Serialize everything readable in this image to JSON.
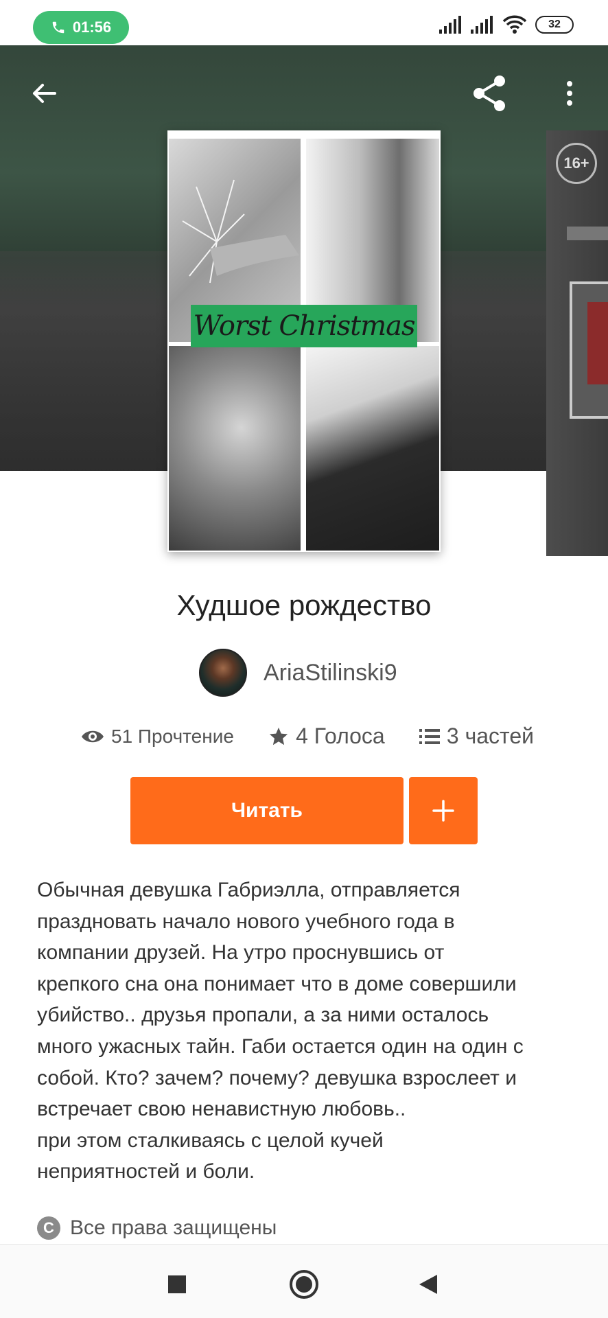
{
  "status_bar": {
    "call_time": "01:56",
    "battery": "32"
  },
  "hero": {
    "cover_title": "Worst Christmas",
    "next_cover_age": "16+"
  },
  "book": {
    "title": "Худшое рождество",
    "author": "AriaStilinski9",
    "reads": "51 Прочтение",
    "votes": "4 Голоса",
    "parts": "3 частей",
    "read_label": "Читать",
    "add_label": "+",
    "description": "Обычная девушка Габриэлла, отправляется\nпраздновать начало нового учебного года в\nкомпании друзей. На утро проснувшись от\nкрепкого сна она понимает что в доме совершили\nубийство.. друзья пропали, а  за ними осталось\nмного ужасных тайн. Габи остается один на один с\nсобой. Кто? зачем? почему? девушка взрослеет и\nвстречает свою ненавистную любовь..\nпри этом сталкиваясь с целой кучей\nнеприятностей и боли.",
    "rights": "Все права защищены",
    "copyright_symbol": "C"
  },
  "colors": {
    "accent": "#ff6b1a",
    "call_pill": "#3fbf73",
    "cover_band": "#27a65a"
  }
}
